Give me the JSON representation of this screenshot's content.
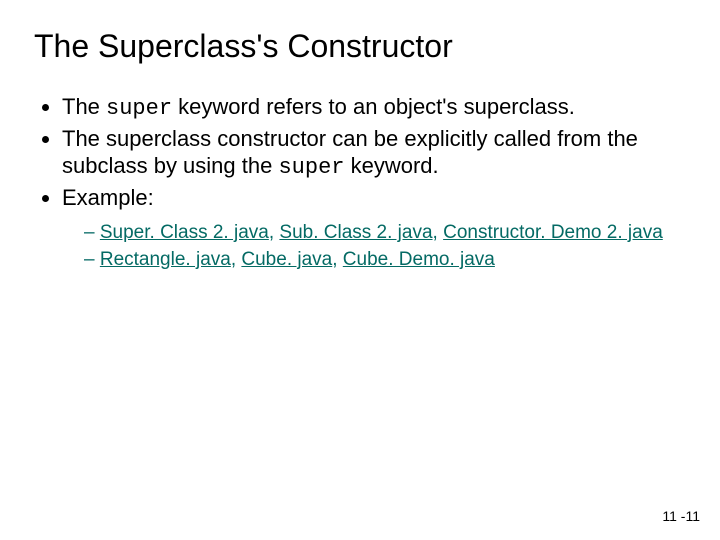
{
  "title": "The Superclass's Constructor",
  "bullets": {
    "b1_pre": "The ",
    "b1_kw": "super",
    "b1_post": " keyword refers to an object's superclass.",
    "b2_pre": "The superclass constructor can be explicitly called from the subclass by using the ",
    "b2_kw": "super",
    "b2_post": " keyword.",
    "b3": "Example:"
  },
  "links": {
    "l1": "Super. Class 2. java",
    "l2": "Sub. Class 2. java",
    "l3": "Constructor. Demo 2. java",
    "l4": "Rectangle. java",
    "l5": "Cube. java",
    "l6": "Cube. Demo. java",
    "sep": ", "
  },
  "footer": "11 -11"
}
